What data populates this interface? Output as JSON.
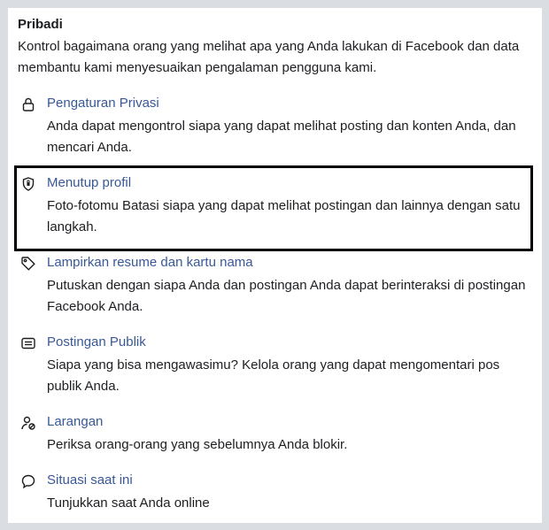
{
  "section": {
    "title": "Pribadi",
    "description": "Kontrol bagaimana orang yang melihat apa yang Anda lakukan di Facebook dan data membantu kami menyesuaikan pengalaman pengguna kami."
  },
  "items": [
    {
      "icon": "lock-icon",
      "title": "Pengaturan Privasi",
      "description": "Anda dapat mengontrol siapa yang dapat melihat posting dan konten Anda, dan mencari Anda."
    },
    {
      "icon": "shield-icon",
      "title": "Menutup profil",
      "description": "Foto-fotomu Batasi siapa yang dapat melihat postingan dan lainnya dengan satu langkah."
    },
    {
      "icon": "tag-icon",
      "title": "Lampirkan resume dan kartu nama",
      "description": "Putuskan dengan siapa Anda dan postingan Anda dapat berinteraksi di postingan Facebook Anda."
    },
    {
      "icon": "post-icon",
      "title": "Postingan Publik",
      "description": "Siapa yang bisa mengawasimu? Kelola orang yang dapat mengomentari pos publik Anda."
    },
    {
      "icon": "blocking-icon",
      "title": "Larangan",
      "description": "Periksa orang-orang yang sebelumnya Anda blokir."
    },
    {
      "icon": "chat-bubble-icon",
      "title": "Situasi saat ini",
      "description": "Tunjukkan saat Anda online"
    }
  ],
  "colors": {
    "link": "#385898",
    "text": "#1c1e21",
    "background": "#dadde1",
    "highlight_border": "#000000"
  }
}
